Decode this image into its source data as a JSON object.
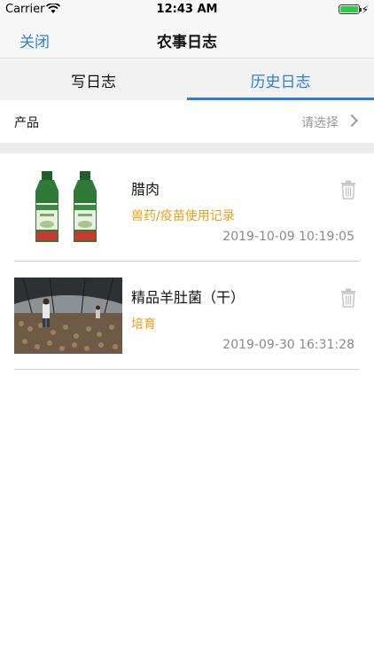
{
  "status_bar": {
    "carrier": "Carrier",
    "time": "12:43 AM",
    "battery_level": 1.0,
    "icons": [
      "wifi-icon",
      "battery-icon",
      "charging-icon"
    ]
  },
  "nav": {
    "close_label": "关闭",
    "title": "农事日志"
  },
  "tabs": [
    {
      "label": "写日志",
      "active": false
    },
    {
      "label": "历史日志",
      "active": true
    }
  ],
  "filter": {
    "label": "产品",
    "value": "请选择"
  },
  "logs": [
    {
      "name": "腊肉",
      "type": "兽药/疫苗使用记录",
      "date": "2019-10-09 10:19:05",
      "thumbnail": "vaccine-bottles-image"
    },
    {
      "name": "精品羊肚菌（干）",
      "type": "培育",
      "date": "2019-09-30 16:31:28",
      "thumbnail": "greenhouse-image"
    }
  ],
  "colors": {
    "accent": "#2b7fd8",
    "type_text": "#e3a21a",
    "date_text": "#8a8a8a",
    "separator": "#ececec"
  }
}
